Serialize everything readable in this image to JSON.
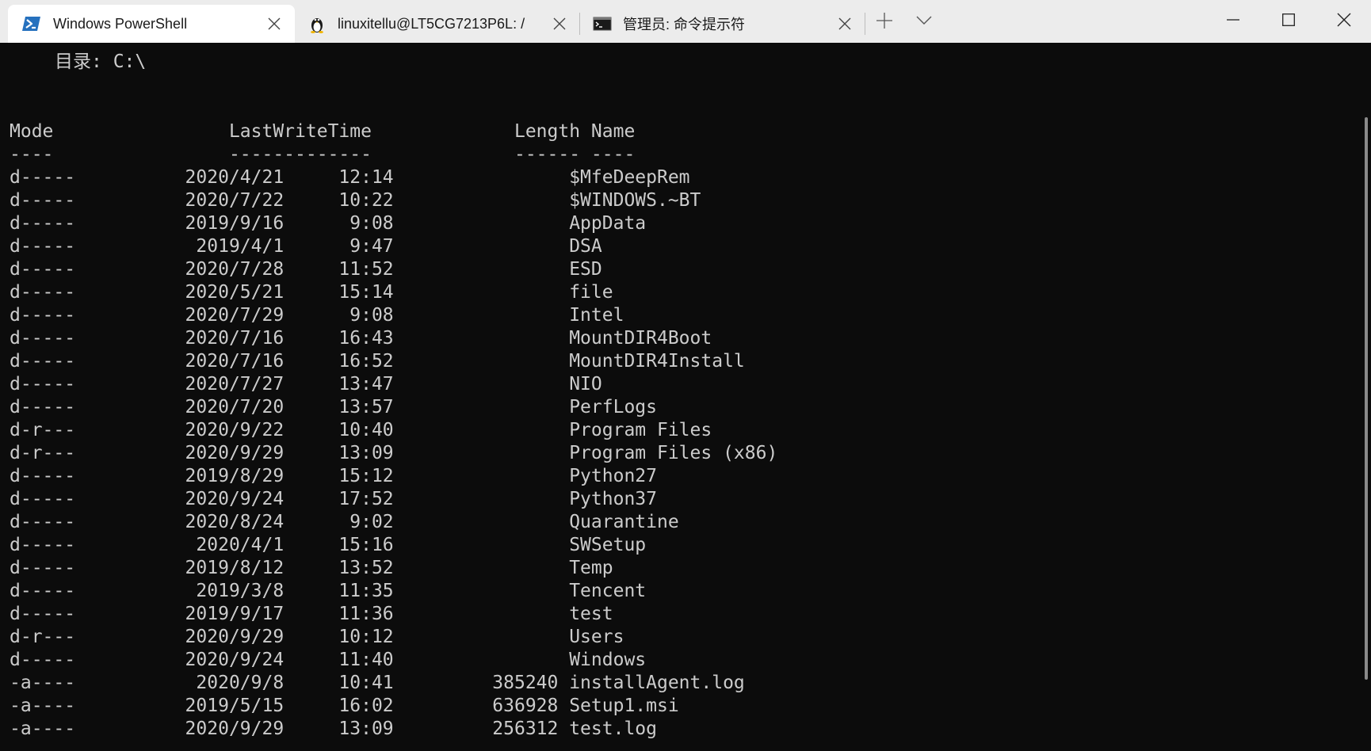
{
  "tabs": [
    {
      "title": "Windows PowerShell",
      "icon": "powershell-icon",
      "active": true
    },
    {
      "title": "linuxitellu@LT5CG7213P6L: /",
      "icon": "linux-penguin-icon",
      "active": false
    },
    {
      "title": "管理员: 命令提示符",
      "icon": "cmd-icon",
      "active": false
    }
  ],
  "directory_label": "目录: C:\\",
  "listing": {
    "headers": {
      "mode": "Mode",
      "lastwritetime": "LastWriteTime",
      "length": "Length",
      "name": "Name"
    },
    "separators": {
      "mode": "----",
      "lastwritetime": "-------------",
      "length": "------",
      "name": "----"
    },
    "rows": [
      {
        "mode": "d-----",
        "date": "2020/4/21",
        "time": "12:14",
        "length": "",
        "name": "$MfeDeepRem"
      },
      {
        "mode": "d-----",
        "date": "2020/7/22",
        "time": "10:22",
        "length": "",
        "name": "$WINDOWS.~BT"
      },
      {
        "mode": "d-----",
        "date": "2019/9/16",
        "time": "9:08",
        "length": "",
        "name": "AppData"
      },
      {
        "mode": "d-----",
        "date": "2019/4/1",
        "time": "9:47",
        "length": "",
        "name": "DSA"
      },
      {
        "mode": "d-----",
        "date": "2020/7/28",
        "time": "11:52",
        "length": "",
        "name": "ESD"
      },
      {
        "mode": "d-----",
        "date": "2020/5/21",
        "time": "15:14",
        "length": "",
        "name": "file"
      },
      {
        "mode": "d-----",
        "date": "2020/7/29",
        "time": "9:08",
        "length": "",
        "name": "Intel"
      },
      {
        "mode": "d-----",
        "date": "2020/7/16",
        "time": "16:43",
        "length": "",
        "name": "MountDIR4Boot"
      },
      {
        "mode": "d-----",
        "date": "2020/7/16",
        "time": "16:52",
        "length": "",
        "name": "MountDIR4Install"
      },
      {
        "mode": "d-----",
        "date": "2020/7/27",
        "time": "13:47",
        "length": "",
        "name": "NIO"
      },
      {
        "mode": "d-----",
        "date": "2020/7/20",
        "time": "13:57",
        "length": "",
        "name": "PerfLogs"
      },
      {
        "mode": "d-r---",
        "date": "2020/9/22",
        "time": "10:40",
        "length": "",
        "name": "Program Files"
      },
      {
        "mode": "d-r---",
        "date": "2020/9/29",
        "time": "13:09",
        "length": "",
        "name": "Program Files (x86)"
      },
      {
        "mode": "d-----",
        "date": "2019/8/29",
        "time": "15:12",
        "length": "",
        "name": "Python27"
      },
      {
        "mode": "d-----",
        "date": "2020/9/24",
        "time": "17:52",
        "length": "",
        "name": "Python37"
      },
      {
        "mode": "d-----",
        "date": "2020/8/24",
        "time": "9:02",
        "length": "",
        "name": "Quarantine"
      },
      {
        "mode": "d-----",
        "date": "2020/4/1",
        "time": "15:16",
        "length": "",
        "name": "SWSetup"
      },
      {
        "mode": "d-----",
        "date": "2019/8/12",
        "time": "13:52",
        "length": "",
        "name": "Temp"
      },
      {
        "mode": "d-----",
        "date": "2019/3/8",
        "time": "11:35",
        "length": "",
        "name": "Tencent"
      },
      {
        "mode": "d-----",
        "date": "2019/9/17",
        "time": "11:36",
        "length": "",
        "name": "test"
      },
      {
        "mode": "d-r---",
        "date": "2020/9/29",
        "time": "10:12",
        "length": "",
        "name": "Users"
      },
      {
        "mode": "d-----",
        "date": "2020/9/24",
        "time": "11:40",
        "length": "",
        "name": "Windows"
      },
      {
        "mode": "-a----",
        "date": "2020/9/8",
        "time": "10:41",
        "length": "385240",
        "name": "installAgent.log"
      },
      {
        "mode": "-a----",
        "date": "2019/5/15",
        "time": "16:02",
        "length": "636928",
        "name": "Setup1.msi"
      },
      {
        "mode": "-a----",
        "date": "2020/9/29",
        "time": "13:09",
        "length": "256312",
        "name": "test.log"
      }
    ]
  },
  "colors": {
    "terminal_background": "#0c0c0c",
    "terminal_foreground": "#cccccc",
    "tabbar_background": "#ececec",
    "active_tab_background": "#ffffff",
    "powershell_blue": "#2671be"
  }
}
